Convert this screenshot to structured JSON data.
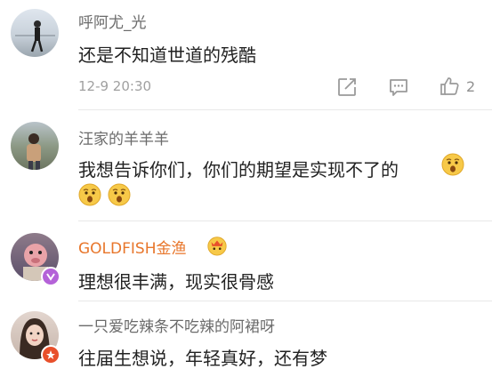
{
  "comments": [
    {
      "username": "呼阿尤_光",
      "text": "还是不知道世道的残酷",
      "time": "12-9 20:30",
      "likes": "2"
    },
    {
      "username": "汪家的羊羊羊",
      "text": "我想告诉你们，你们的期望是实现不了的"
    },
    {
      "username": "GOLDFISH金渔",
      "text": "理想很丰满，现实很骨感"
    },
    {
      "username": "一只爱吃辣条不吃辣的阿裙呀",
      "text": "往届生想说，年轻真好，还有梦"
    }
  ],
  "colors": {
    "username": "#6b6b6b",
    "vip_username": "#e8762b",
    "meta": "#a0a0a0"
  }
}
